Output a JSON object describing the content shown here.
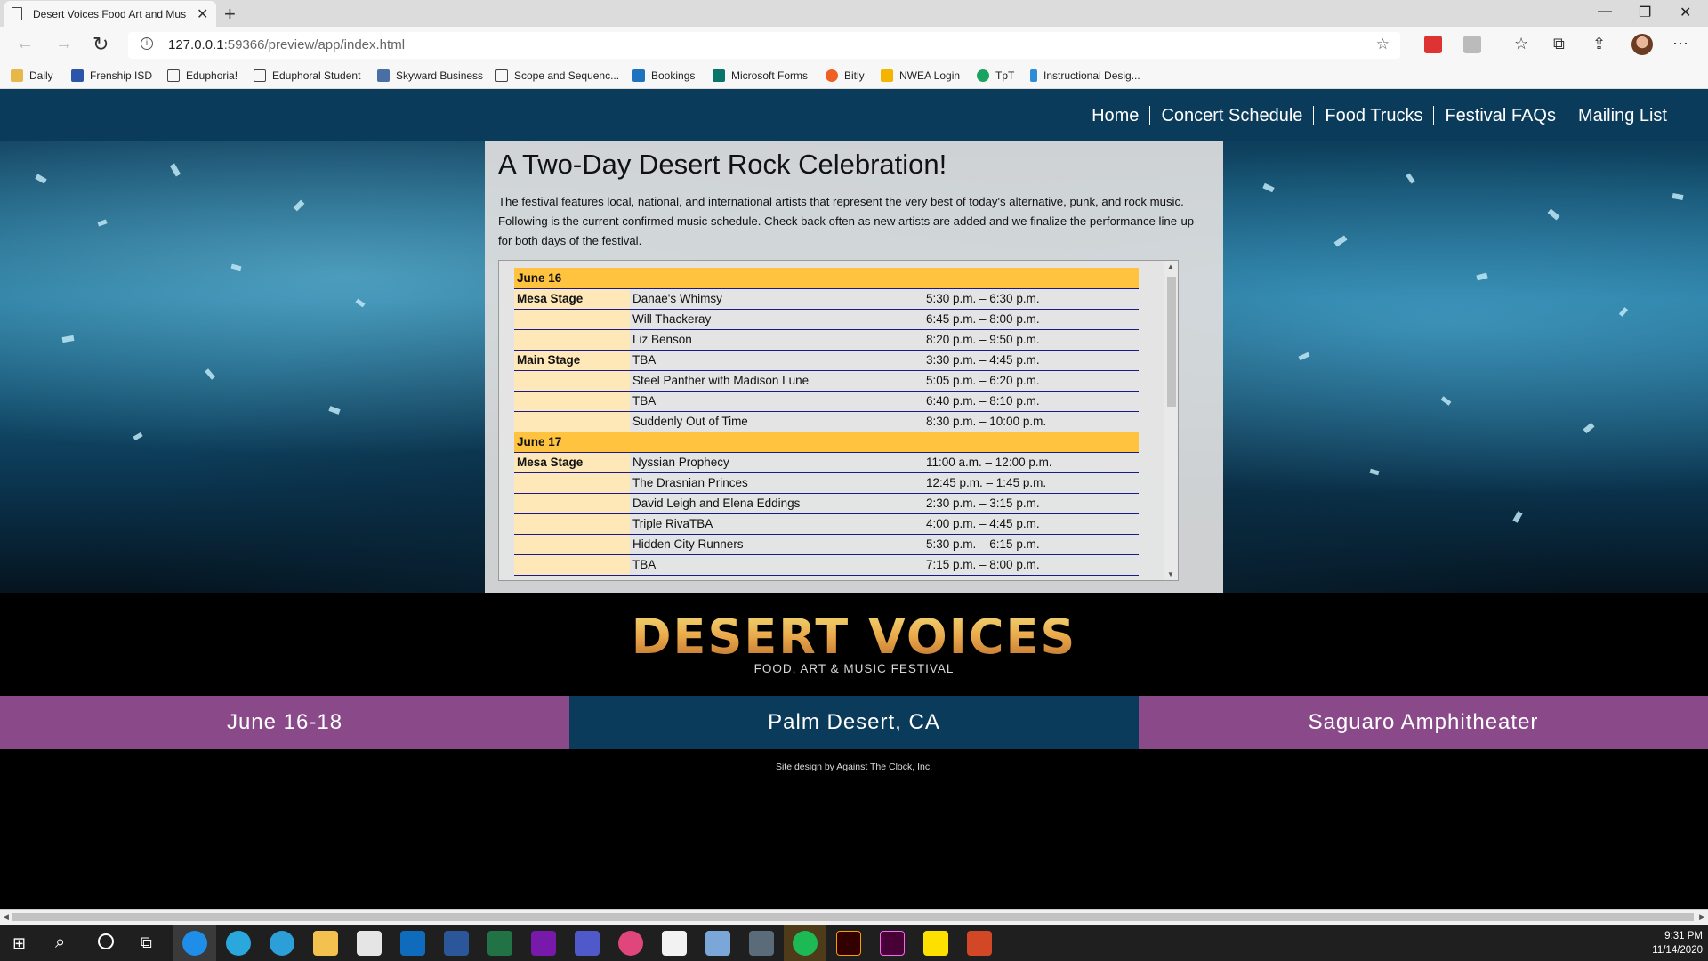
{
  "browser": {
    "tab_title": "Desert Voices Food Art and Mus",
    "new_tab": "+",
    "url_host": "127.0.0.1",
    "url_rest": ":59366/preview/app/index.html",
    "bookmarks": [
      "Daily",
      "Frenship ISD",
      "Eduphoria!",
      "Eduphoral Student",
      "Skyward Business",
      "Scope and Sequenc...",
      "Bookings",
      "Microsoft Forms",
      "Bitly",
      "NWEA Login",
      "TpT",
      "Instructional Desig..."
    ]
  },
  "site": {
    "nav": [
      "Home",
      "Concert Schedule",
      "Food Trucks",
      "Festival FAQs",
      "Mailing List"
    ],
    "heading": "A Two-Day Desert Rock Celebration!",
    "intro": "The festival features local, national, and international artists that represent the very best of today's alternative, punk, and rock music. Following is the current confirmed music schedule. Check back often as new artists are added and we finalize the performance line-up for both days of the festival.",
    "schedule": {
      "day1": "June 16",
      "day2": "June 17",
      "rows": [
        {
          "stage": "Mesa Stage",
          "act": "Danae's Whimsy",
          "time": "5:30 p.m. – 6:30 p.m."
        },
        {
          "stage": "",
          "act": "Will Thackeray",
          "time": "6:45 p.m. – 8:00 p.m."
        },
        {
          "stage": "",
          "act": "Liz Benson",
          "time": "8:20 p.m. – 9:50 p.m."
        },
        {
          "stage": "Main Stage",
          "act": "TBA",
          "time": "3:30 p.m. – 4:45 p.m."
        },
        {
          "stage": "",
          "act": "Steel Panther with Madison Lune",
          "time": "5:05 p.m. – 6:20 p.m."
        },
        {
          "stage": "",
          "act": "TBA",
          "time": "6:40 p.m. – 8:10 p.m."
        },
        {
          "stage": "",
          "act": "Suddenly Out of Time",
          "time": "8:30 p.m. – 10:00 p.m."
        },
        {
          "stage": "Mesa Stage",
          "act": "Nyssian Prophecy",
          "time": "11:00 a.m. – 12:00 p.m."
        },
        {
          "stage": "",
          "act": "The Drasnian Princes",
          "time": "12:45 p.m. – 1:45 p.m."
        },
        {
          "stage": "",
          "act": "David Leigh and Elena Eddings",
          "time": "2:30 p.m. – 3:15 p.m."
        },
        {
          "stage": "",
          "act": "Triple RivaTBA",
          "time": "4:00 p.m. – 4:45 p.m."
        },
        {
          "stage": "",
          "act": "Hidden City Runners",
          "time": "5:30 p.m. – 6:15 p.m."
        },
        {
          "stage": "",
          "act": "TBA",
          "time": "7:15 p.m. – 8:00 p.m."
        }
      ]
    },
    "logo_main": "DESERT VOICES",
    "logo_sub": "FOOD, ART & MUSIC FESTIVAL",
    "info": {
      "dates": "June 16-18",
      "city": "Palm Desert, CA",
      "venue": "Saguaro Amphitheater"
    },
    "credit_prefix": "Site design by ",
    "credit_link": "Against The Clock, Inc."
  },
  "taskbar": {
    "time": "9:31 PM",
    "date": "11/14/2020"
  }
}
